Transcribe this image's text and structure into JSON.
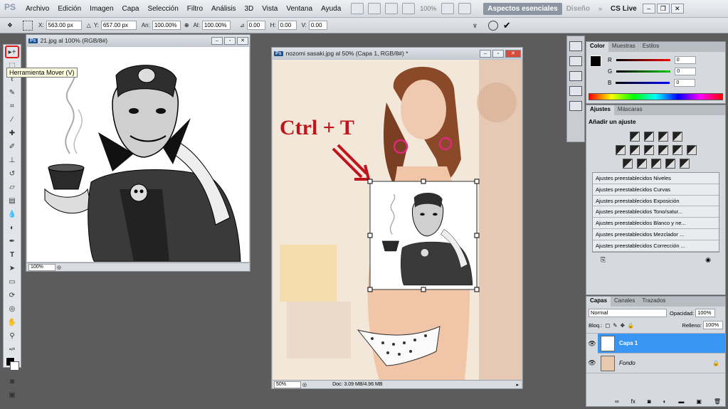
{
  "menubar": {
    "logo": "PS",
    "items": [
      "Archivo",
      "Edición",
      "Imagen",
      "Capa",
      "Selección",
      "Filtro",
      "Análisis",
      "3D",
      "Vista",
      "Ventana",
      "Ayuda"
    ],
    "zoom": "100%",
    "workspace_active": "Aspectos esenciales",
    "workspace_inactive": "Diseño",
    "cslive": "CS Live"
  },
  "options": {
    "x_label": "X:",
    "x_value": "563.00 px",
    "y_label": "Y:",
    "y_value": "657.00 px",
    "w_label": "An:",
    "w_value": "100.00%",
    "h_label": "Al:",
    "h_value": "100.00%",
    "angle_value": "0.00",
    "hskew_label": "H:",
    "hskew_value": "0.00",
    "vskew_label": "V:",
    "vskew_value": "0.00"
  },
  "toolbox": {
    "tooltip": "Herramienta Mover (V)"
  },
  "doc1": {
    "badge": "Ps",
    "title": "21.jpg al 100% (RGB/8#)",
    "zoom": "100%"
  },
  "doc2": {
    "badge": "Ps",
    "title": "nozomi sasaki.jpg al 50% (Capa 1, RGB/8#) *",
    "zoom": "50%",
    "info": "Doc: 3.09 MB/4.96 MB",
    "annotation": "Ctrl + T"
  },
  "color_panel": {
    "tabs": [
      "Color",
      "Muestras",
      "Estilos"
    ],
    "r_label": "R",
    "r_value": "0",
    "g_label": "G",
    "g_value": "0",
    "b_label": "B",
    "b_value": "0"
  },
  "adjust_panel": {
    "tabs": [
      "Ajustes",
      "Máscaras"
    ],
    "heading": "Añadir un ajuste",
    "presets": [
      "Ajustes preestablecidos Niveles",
      "Ajustes preestablecidos Curvas",
      "Ajustes preestablecidos Exposición",
      "Ajustes preestablecidos Tono/satur...",
      "Ajustes preestablecidos Blanco y ne...",
      "Ajustes preestablecidos Mezclador ...",
      "Ajustes preestablecidos Corrección ..."
    ]
  },
  "layers_panel": {
    "tabs": [
      "Capas",
      "Canales",
      "Trazados"
    ],
    "blend_mode": "Normal",
    "opacity_label": "Opacidad:",
    "opacity_value": "100%",
    "lock_label": "Bloq.:",
    "fill_label": "Relleno:",
    "fill_value": "100%",
    "layers": [
      {
        "name": "Capa 1"
      },
      {
        "name": "Fondo"
      }
    ]
  },
  "colors": {
    "accent_selected": "#3896f2",
    "annotation_red": "#c0141c"
  }
}
